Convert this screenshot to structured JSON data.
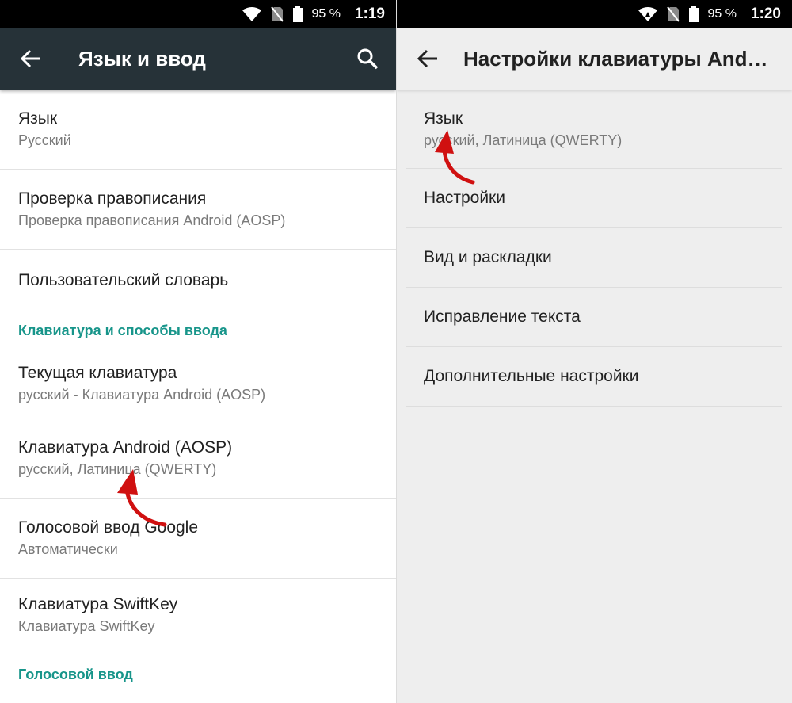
{
  "left": {
    "status": {
      "battery": "95 %",
      "time": "1:19"
    },
    "toolbar": {
      "title": "Язык и ввод"
    },
    "items": [
      {
        "title": "Язык",
        "subtitle": "Русский"
      },
      {
        "title": "Проверка правописания",
        "subtitle": "Проверка правописания Android (AOSP)"
      },
      {
        "title": "Пользовательский словарь"
      }
    ],
    "category1": "Клавиатура и способы ввода",
    "keyboards": [
      {
        "title": "Текущая клавиатура",
        "subtitle": "русский - Клавиатура Android (AOSP)"
      },
      {
        "title": "Клавиатура Android (AOSP)",
        "subtitle": "русский, Латиница (QWERTY)"
      },
      {
        "title": "Голосовой ввод Google",
        "subtitle": "Автоматически"
      },
      {
        "title": "Клавиатура SwiftKey",
        "subtitle": "Клавиатура SwiftKey"
      }
    ],
    "category2": "Голосовой ввод"
  },
  "right": {
    "status": {
      "battery": "95 %",
      "time": "1:20"
    },
    "toolbar": {
      "title": "Настройки клавиатуры And…"
    },
    "first": {
      "title": "Язык",
      "subtitle": "русский, Латиница (QWERTY)"
    },
    "items": [
      {
        "title": "Настройки"
      },
      {
        "title": "Вид и раскладки"
      },
      {
        "title": "Исправление текста"
      },
      {
        "title": "Дополнительные настройки"
      }
    ]
  },
  "colors": {
    "accent": "#17958a",
    "toolbar_dark": "#263238",
    "annotation": "#d01010"
  },
  "icons": [
    "wifi-icon",
    "no-sim-icon",
    "battery-icon",
    "back-arrow-icon",
    "search-icon",
    "annotation-arrow"
  ]
}
